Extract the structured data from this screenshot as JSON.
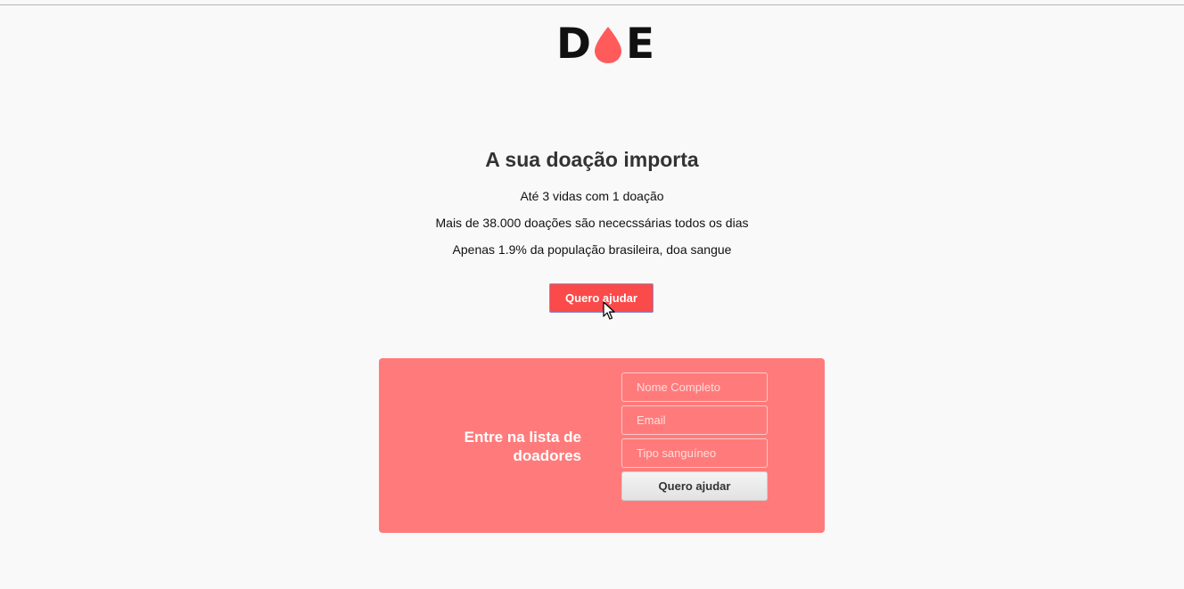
{
  "brand": {
    "logo_left": "D",
    "logo_right": "E",
    "logo_accent_color": "#ff5b5b"
  },
  "hero": {
    "title": "A sua doação importa",
    "facts": [
      "Até 3 vidas com 1 doação",
      "Mais de 38.000 doações são nececssárias todos os dias",
      "Apenas 1.9% da população brasileira, doa sangue"
    ],
    "cta_label": "Quero ajudar"
  },
  "signup": {
    "title": "Entre na lista de doadores",
    "name_placeholder": "Nome Completo",
    "email_placeholder": "Email",
    "blood_placeholder": "Tipo sanguíneo",
    "submit_label": "Quero ajudar"
  },
  "colors": {
    "background": "#f9f9f9",
    "cta": "#fa4a4a",
    "panel": "#ff7b7b"
  }
}
